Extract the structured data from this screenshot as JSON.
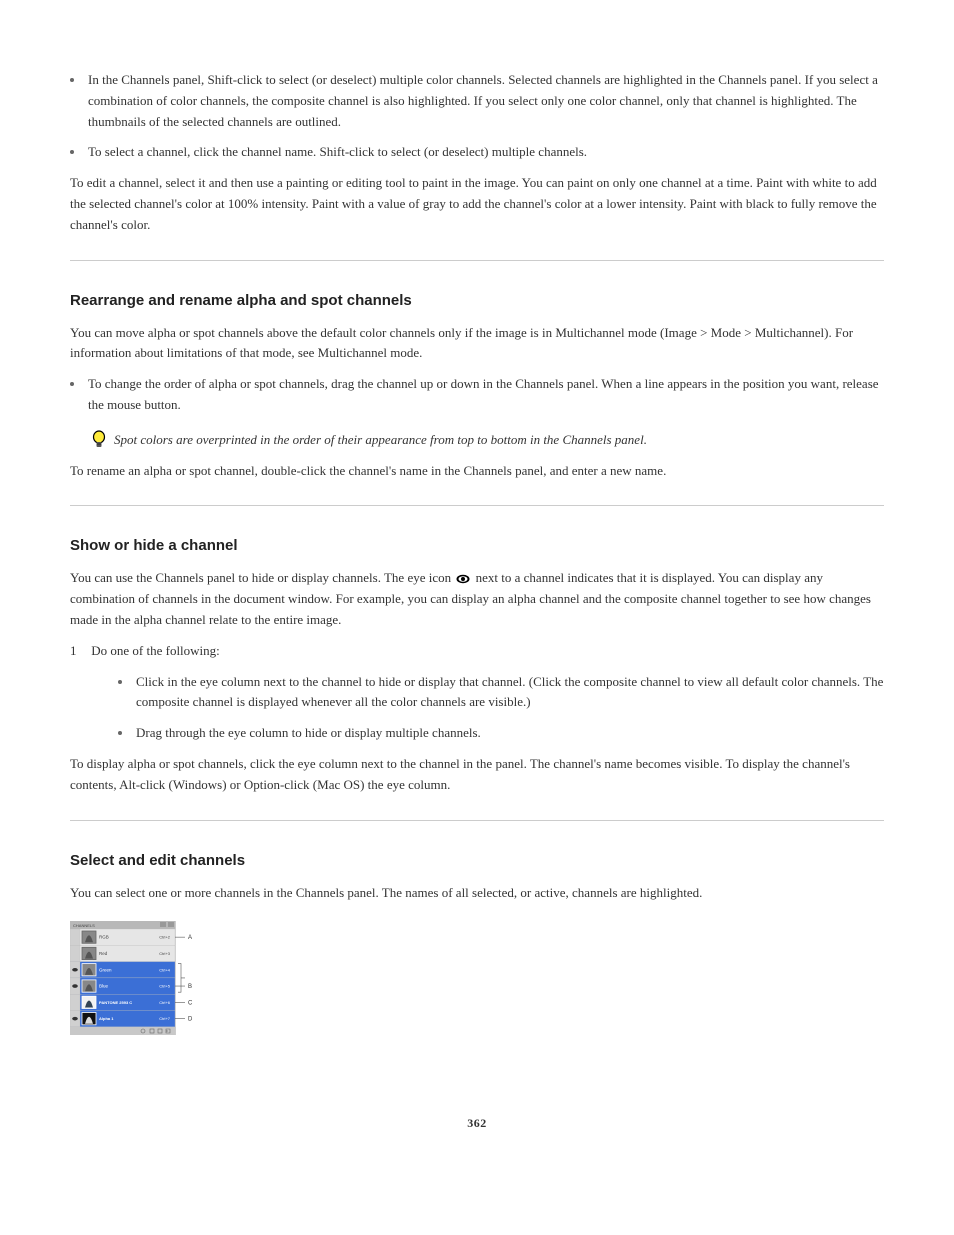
{
  "section1": {
    "bullet1": "In the Channels panel, Shift-click to select (or deselect) multiple color channels. Selected channels are highlighted in the Channels panel. If you select a combination of color channels, the composite channel is also highlighted. If you select only one color channel, only that channel is highlighted. The thumbnails of the selected channels are outlined.",
    "bullet2": "To select a channel, click the channel name. Shift-click to select (or deselect) multiple channels.",
    "para": "To edit a channel, select it and then use a painting or editing tool to paint in the image. You can paint on only one channel at a time. Paint with white to add the selected channel's color at 100% intensity. Paint with a value of gray to add the channel's color at a lower intensity. Paint with black to fully remove the channel's color."
  },
  "section2": {
    "heading": "Rearrange and rename alpha and spot channels",
    "para1": "You can move alpha or spot channels above the default color channels only if the image is in Multichannel mode (Image > Mode > Multichannel). For information about limitations of that mode, see Multichannel mode.",
    "bullet": "To change the order of alpha or spot channels, drag the channel up or down in the Channels panel. When a line appears in the position you want, release the mouse button.",
    "tip": "Spot colors are overprinted in the order of their appearance from top to bottom in the Channels panel.",
    "para2": "To rename an alpha or spot channel, double-click the channel's name in the Channels panel, and enter a new name."
  },
  "section3": {
    "heading": "Show or hide a channel",
    "para1_before": "You can use the Channels panel to hide or display channels. The eye icon ",
    "para1_after": " next to a channel indicates that it is displayed. You can display any combination of channels in the document window. For example, you can display an alpha channel and the composite channel together to see how changes made in the alpha channel relate to the entire image.",
    "num_label": "1",
    "num_text": "Do one of the following:",
    "bullet1": "Click in the eye column next to the channel to hide or display that channel. (Click the composite channel to view all default color channels. The composite channel is displayed whenever all the color channels are visible.)",
    "bullet2": "Drag through the eye column to hide or display multiple channels.",
    "para2": "To display alpha or spot channels, click the eye column next to the channel in the panel. The channel's name becomes visible. To display the channel's contents, Alt-click (Windows) or Option-click (Mac OS) the eye column."
  },
  "section4": {
    "heading": "Select and edit channels",
    "para": "You can select one or more channels in the Channels panel. The names of all selected, or active, channels are highlighted.",
    "panel": {
      "title": "CHANNELS",
      "rows": [
        {
          "name": "RGB",
          "shortcut": "Ctrl+2",
          "eye": false,
          "selected": false,
          "label": "A"
        },
        {
          "name": "Red",
          "shortcut": "Ctrl+3",
          "eye": false,
          "selected": false
        },
        {
          "name": "Green",
          "shortcut": "Ctrl+4",
          "eye": true,
          "selected": true,
          "label_group_start": true
        },
        {
          "name": "Blue",
          "shortcut": "Ctrl+5",
          "eye": true,
          "selected": true,
          "label": "B"
        },
        {
          "name": "PANTONE 2593 C",
          "shortcut": "Ctrl+6",
          "eye": false,
          "selected": true,
          "spot": true,
          "label": "C"
        },
        {
          "name": "Alpha 1",
          "shortcut": "Ctrl+7",
          "eye": true,
          "selected": true,
          "alpha": true,
          "label": "D"
        }
      ]
    }
  },
  "page_number": "362",
  "icons": {
    "tip": "tip-icon",
    "eye": "eye-icon"
  }
}
